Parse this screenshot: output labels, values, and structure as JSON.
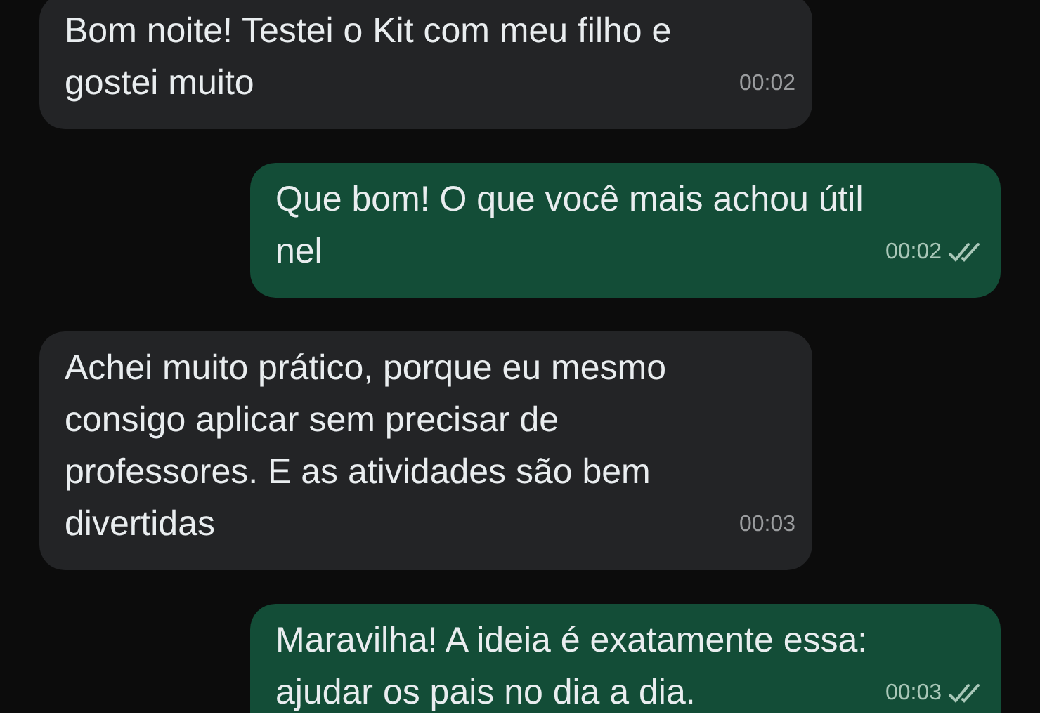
{
  "messages": [
    {
      "kind": "incoming",
      "text": "Bom noite! Testei o Kit com meu filho e gostei muito",
      "time": "00:02"
    },
    {
      "kind": "outgoing",
      "text": "Que bom! O que você mais achou útil nel",
      "time": "00:02",
      "read": false
    },
    {
      "kind": "incoming",
      "text": "Achei muito prático, porque eu mesmo consigo aplicar sem precisar de professores. E as atividades são bem divertidas",
      "time": "00:03"
    },
    {
      "kind": "outgoing",
      "text": "Maravilha! A ideia é exatamente essa: ajudar os pais no dia a dia.",
      "time": "00:03",
      "read": false
    }
  ]
}
